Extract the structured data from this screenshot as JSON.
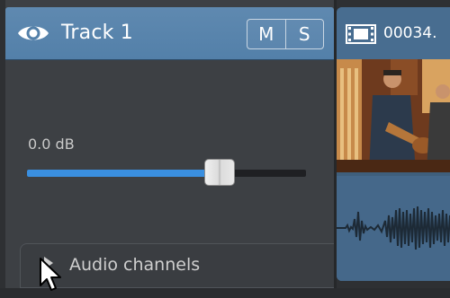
{
  "track": {
    "name": "Track 1",
    "mute_label": "M",
    "solo_label": "S",
    "visibility_icon": "eye-icon"
  },
  "volume": {
    "label": "0.0 dB",
    "level_fraction": 0.69
  },
  "audio_channels": {
    "label": "Audio channels",
    "expanded": false
  },
  "clip": {
    "name": "00034.",
    "icon": "film-strip-icon"
  },
  "colors": {
    "track_header": "#5380a9",
    "slider_fill": "#3a8fe0",
    "clip": "#486d90"
  }
}
